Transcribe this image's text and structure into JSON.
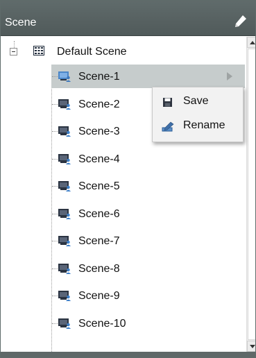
{
  "panel": {
    "title": "Scene",
    "edit_icon": "pencil-icon"
  },
  "tree": {
    "root": {
      "label": "Default Scene",
      "expanded": true,
      "icon": "grid-icon"
    },
    "scenes": [
      {
        "label": "Scene-1",
        "selected": true,
        "has_submenu": true
      },
      {
        "label": "Scene-2"
      },
      {
        "label": "Scene-3"
      },
      {
        "label": "Scene-4"
      },
      {
        "label": "Scene-5"
      },
      {
        "label": "Scene-6"
      },
      {
        "label": "Scene-7"
      },
      {
        "label": "Scene-8"
      },
      {
        "label": "Scene-9"
      },
      {
        "label": "Scene-10"
      }
    ],
    "scene_icon": "monitor-person-icon"
  },
  "context_menu": {
    "items": [
      {
        "label": "Save",
        "icon": "floppy-disk-icon"
      },
      {
        "label": "Rename",
        "icon": "rename-pencil-icon"
      }
    ]
  },
  "colors": {
    "titlebar": "#5a6464",
    "selection": "#c6cccc",
    "menu_bg": "#f2f2f2"
  }
}
